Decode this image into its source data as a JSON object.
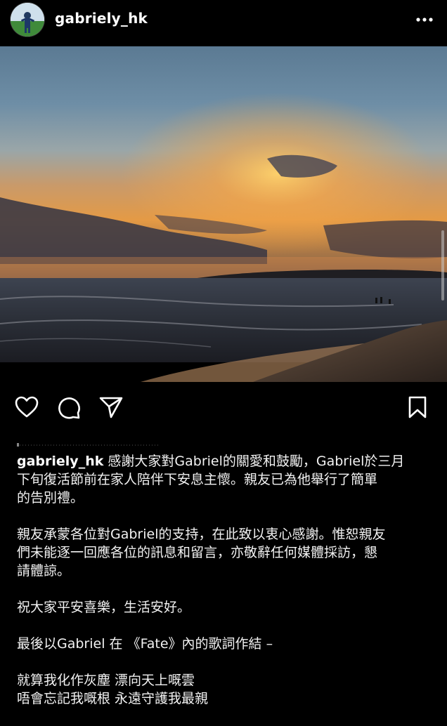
{
  "post": {
    "username": "gabriely_hk",
    "more_icon": "more-horizontal-icon"
  },
  "actions": {
    "like_icon": "heart-icon",
    "comment_icon": "comment-icon",
    "share_icon": "send-icon",
    "save_icon": "bookmark-icon"
  },
  "caption": {
    "username": "gabriely_hk",
    "p1_first": " 感謝大家對Gabriel的關愛和鼓勵，Gabriel於三月",
    "p1_line2": "下旬復活節前在家人陪伴下安息主懷。親友已為他舉行了簡單",
    "p1_line3": "的告別禮。",
    "p2_line1": "親友承蒙各位對Gabriel的支持，在此致以衷心感謝。惟恕親友",
    "p2_line2": "們未能逐一回應各位的訊息和留言，亦敬辭任何媒體採訪，懇",
    "p2_line3": "請體諒。",
    "p3_line1": "祝大家平安喜樂，生活安好。",
    "p4_line1": "最後以Gabriel 在 《Fate》內的歌詞作結 –",
    "p5_line1": "就算我化作灰塵 漂向天上嘅雲",
    "p5_line2": "唔會忘記我嘅根 永遠守護我最親"
  },
  "colors": {
    "background": "#000000",
    "text": "#f2f2f2"
  }
}
